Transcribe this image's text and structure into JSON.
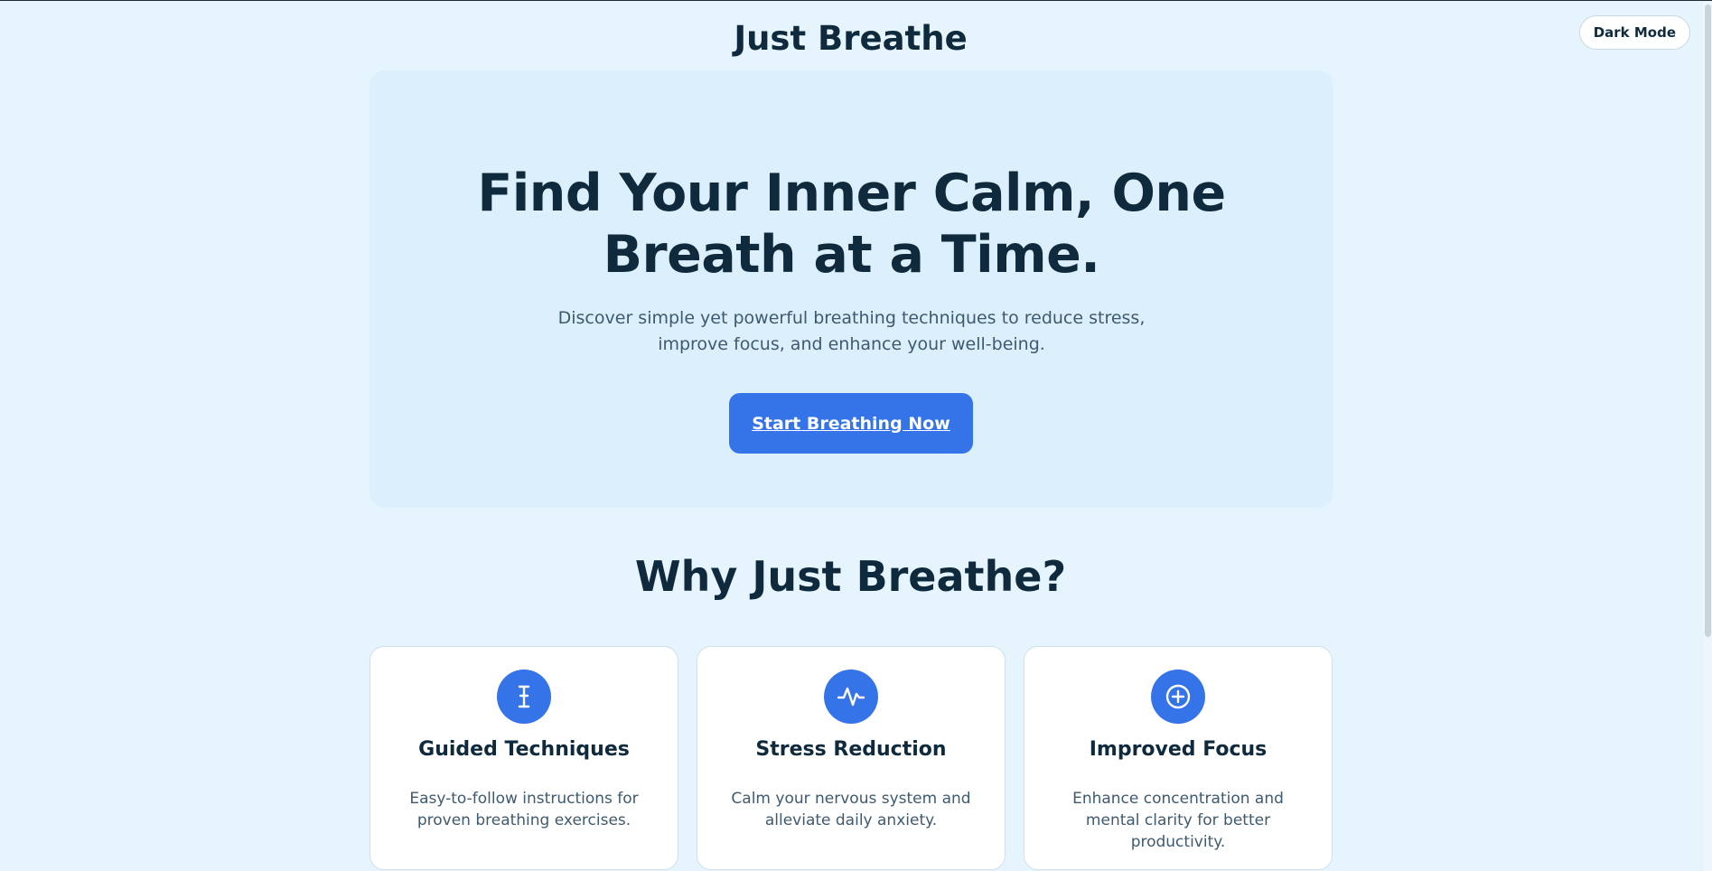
{
  "header": {
    "brand": "Just Breathe",
    "dark_mode_label": "Dark Mode"
  },
  "hero": {
    "title": "Find Your Inner Calm, One Breath at a Time.",
    "subtitle": "Discover simple yet powerful breathing techniques to reduce stress, improve focus, and enhance your well-being.",
    "cta_label": "Start Breathing Now"
  },
  "features": {
    "title": "Why Just Breathe?",
    "cards": [
      {
        "icon": "guided-icon",
        "title": "Guided Techniques",
        "description": "Easy-to-follow instructions for proven breathing exercises."
      },
      {
        "icon": "pulse-icon",
        "title": "Stress Reduction",
        "description": "Calm your nervous system and alleviate daily anxiety."
      },
      {
        "icon": "plus-circle-icon",
        "title": "Improved Focus",
        "description": "Enhance concentration and mental clarity for better productivity."
      }
    ]
  },
  "colors": {
    "background": "#e6f4fd",
    "hero_background": "#dceffd",
    "accent": "#3574e8",
    "text_dark": "#0f2a3d",
    "text_muted": "#3e5a70"
  }
}
